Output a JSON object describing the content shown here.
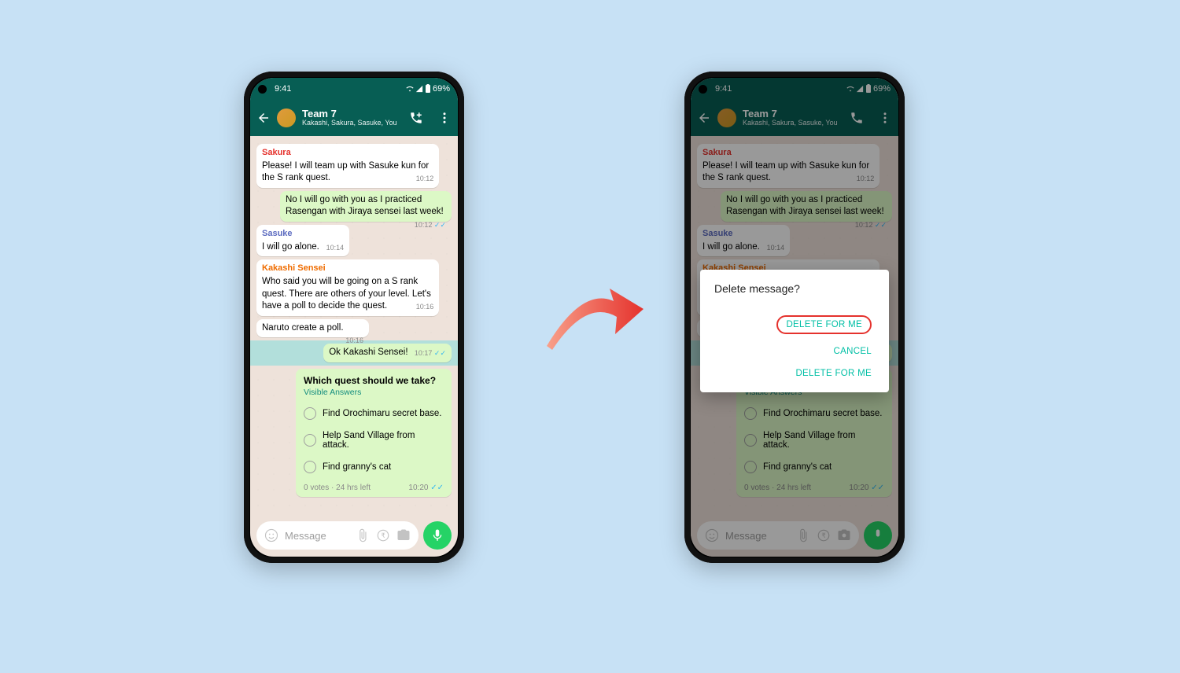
{
  "status": {
    "time": "9:41",
    "battery_text": "69%"
  },
  "header": {
    "group_name": "Team 7",
    "subtitle": "Kakashi, Sakura, Sasuke, You"
  },
  "m": {
    "sakura_name": "Sakura",
    "sakura_body": "Please! I will team up with Sasuke kun for the S rank quest.",
    "sakura_time": "10:12",
    "you1_body": "No I will go with you as I practiced Rasengan with Jiraya sensei last week!",
    "you1_time": "10:12",
    "sasuke_name": "Sasuke",
    "sasuke_body": "I will go alone.",
    "sasuke_time": "10:14",
    "kakashi_name": "Kakashi Sensei",
    "kakashi_body": "Who said you will be going on a S rank quest. There are others of your level. Let's have a poll to decide the quest.",
    "kakashi_time": "10:16",
    "kakashi2_body": "Naruto create a poll.",
    "kakashi2_time": "10:16",
    "you2_body": "Ok Kakashi Sensei!",
    "you2_time": "10:17"
  },
  "poll": {
    "question": "Which quest should we take?",
    "visible": "Visible Answers",
    "o1": "Find Orochimaru secret base.",
    "o2": "Help Sand Village from attack.",
    "o3": "Find granny's cat",
    "meta": "0 votes · 24 hrs left",
    "time": "10:20"
  },
  "input": {
    "placeholder": "Message"
  },
  "dialog": {
    "title": "Delete message?",
    "b1": "DELETE FOR ME",
    "b2": "CANCEL",
    "b3": "DELETE FOR ME"
  },
  "colors": {
    "sakura": "#e5322d",
    "sasuke": "#5c6bc0",
    "kakashi": "#ef6c00"
  }
}
